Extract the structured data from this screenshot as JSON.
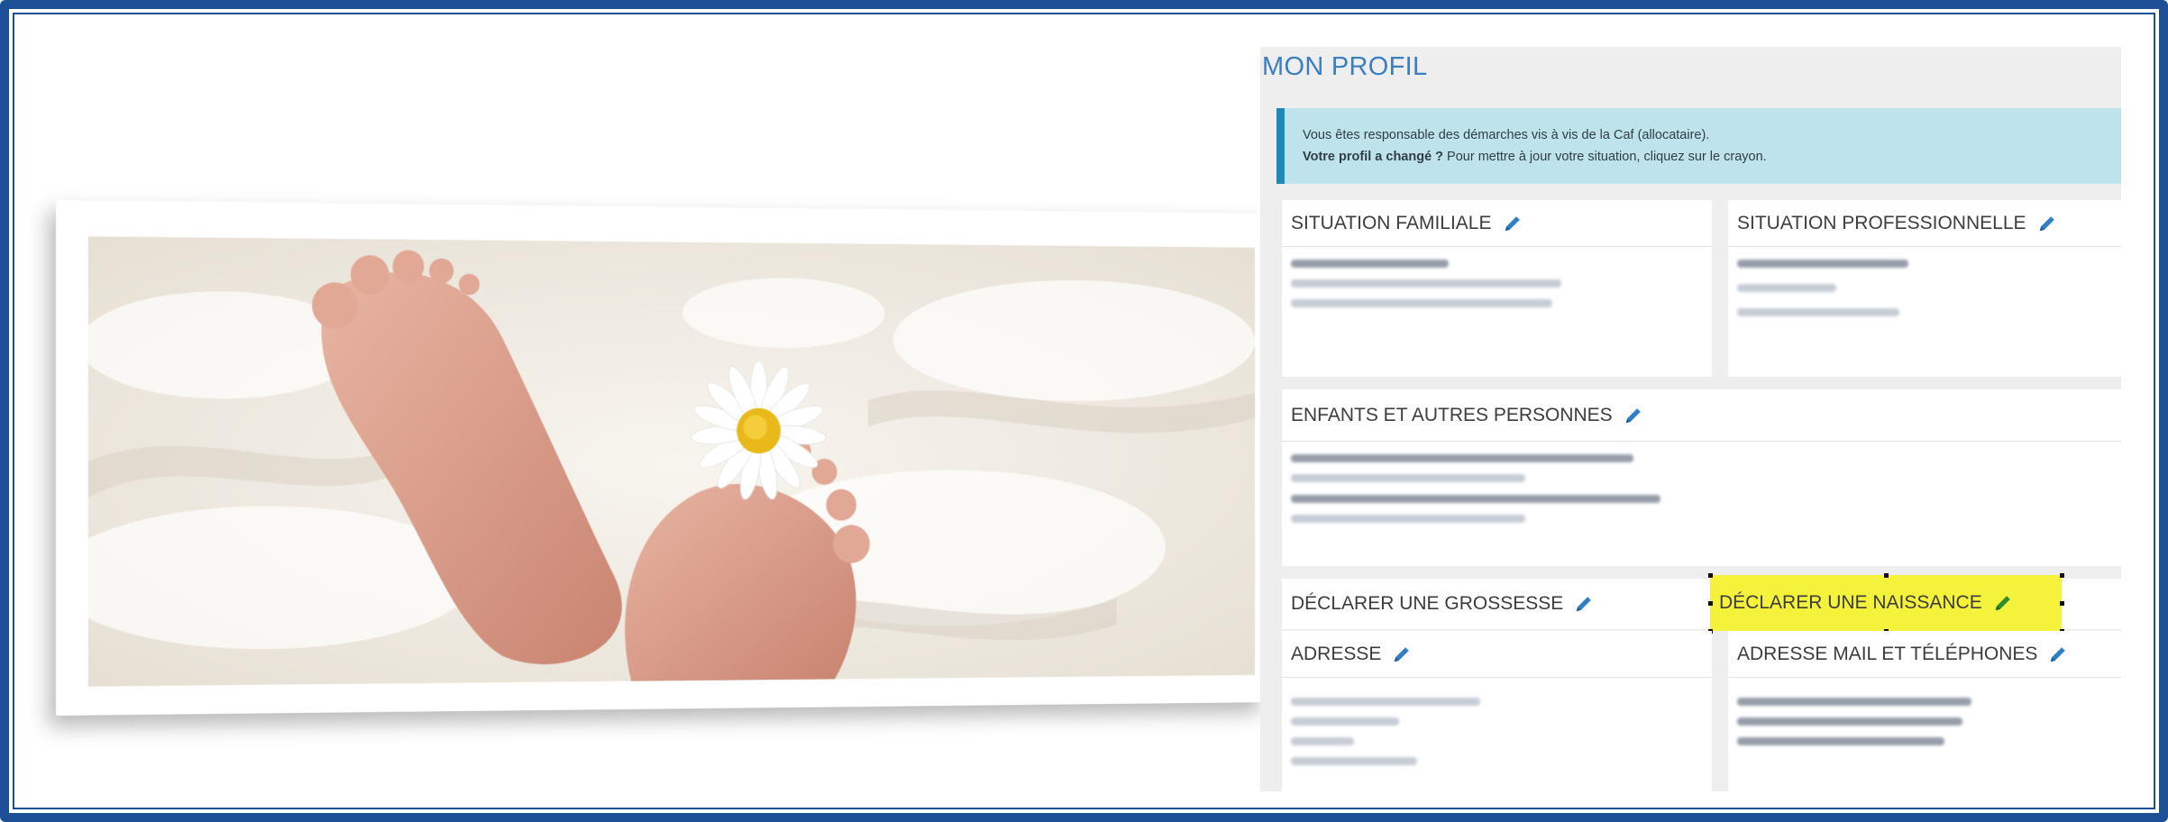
{
  "profile": {
    "title": "MON PROFIL",
    "alert": {
      "line1": "Vous êtes responsable des démarches vis à vis de la Caf (allocataire).",
      "line2_bold": "Votre profil a changé ?",
      "line2_rest": " Pour mettre à jour votre situation, cliquez sur le crayon."
    },
    "sections": {
      "situation_familiale": "SITUATION FAMILIALE",
      "situation_professionnelle": "SITUATION PROFESSIONNELLE",
      "enfants": "ENFANTS ET AUTRES PERSONNES",
      "grossesse": "DÉCLARER UNE GROSSESSE",
      "naissance": "DÉCLARER UNE NAISSANCE",
      "adresse": "ADRESSE",
      "mail_tel": "ADRESSE MAIL ET TÉLÉPHONES"
    }
  },
  "colors": {
    "frame": "#1d4f97",
    "title": "#3a7fc1",
    "alert_bg": "#bee3ea",
    "alert_border": "#1f89b8",
    "pencil": "#2f7fc7",
    "highlight": "#f4f23b",
    "highlight_pencil": "#2e8b2e"
  },
  "icons": {
    "edit": "pencil-icon"
  }
}
